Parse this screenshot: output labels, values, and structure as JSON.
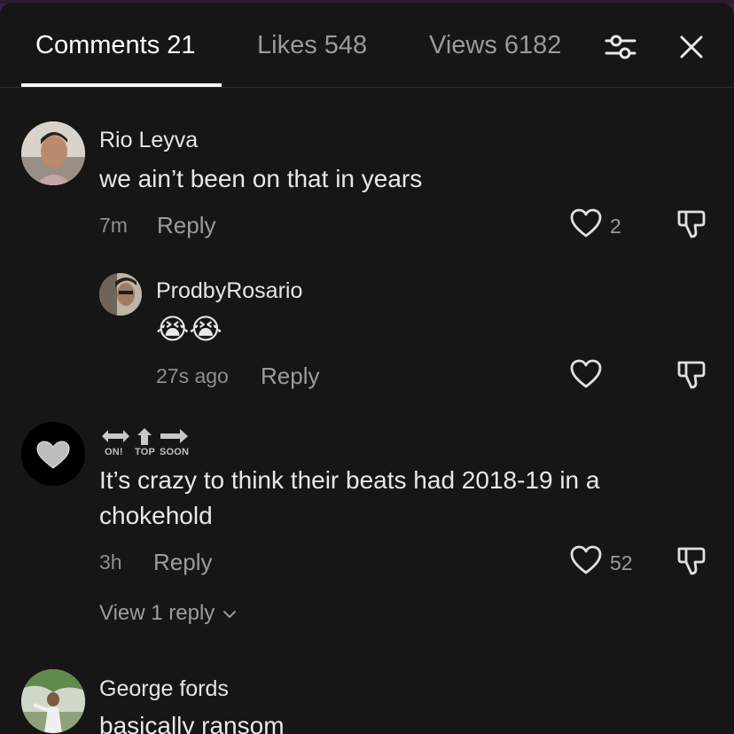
{
  "tabs": [
    {
      "label": "Comments 21"
    },
    {
      "label": "Likes 548"
    },
    {
      "label": "Views 6182"
    }
  ],
  "comments": [
    {
      "author": "Rio Leyva",
      "text": "we ain’t been on that in years",
      "time": "7m",
      "reply_label": "Reply",
      "likes": "2",
      "replies": [
        {
          "author": "ProdbyRosario",
          "text": "😭😭",
          "time": "27s ago",
          "reply_label": "Reply"
        }
      ]
    },
    {
      "author_badge": {
        "left": "ON!",
        "middle": "TOP",
        "right": "SOON"
      },
      "text_line1": "It’s crazy to think their beats had 2018-19 in a",
      "text_line2": "chokehold",
      "time": "3h",
      "reply_label": "Reply",
      "likes": "52",
      "view_replies": "View 1 reply"
    },
    {
      "author": "George fords",
      "text": "basically ransom"
    }
  ],
  "colors": {
    "panel": "#161616",
    "text": "#e8e8e8",
    "muted": "#9c9c9c",
    "backdrop": "#3a2347"
  },
  "icons": [
    "filter-sliders-icon",
    "close-icon",
    "heart-outline-icon",
    "dislike-icon",
    "chevron-down-icon",
    "heart-avatar-icon"
  ]
}
